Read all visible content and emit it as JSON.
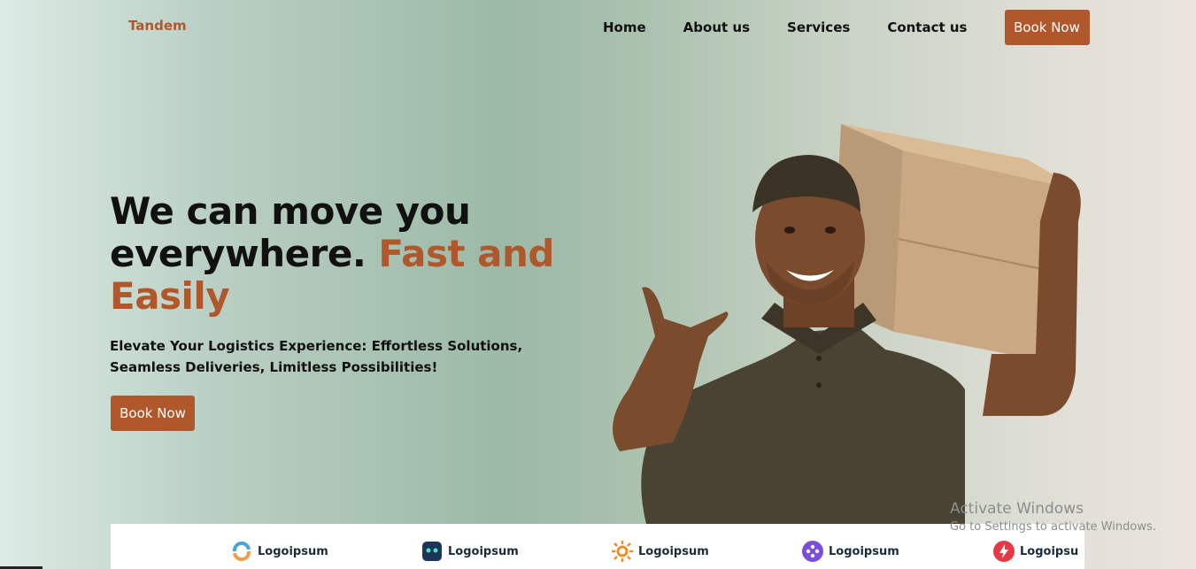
{
  "header": {
    "brand": "Tandem",
    "nav": [
      "Home",
      "About us",
      "Services",
      "Contact us"
    ],
    "cta_label": "Book Now"
  },
  "hero": {
    "title_part1": "We can move you everywhere. ",
    "title_accent": "Fast and Easily",
    "subtitle": "Elevate Your Logistics Experience: Effortless Solutions, Seamless Deliveries, Limitless Possibilities!",
    "cta_label": "Book Now"
  },
  "logos": [
    {
      "label": "Logoipsum",
      "icon": "ring-logo-icon"
    },
    {
      "label": "Logoipsum",
      "icon": "robot-logo-icon"
    },
    {
      "label": "Logoipsum",
      "icon": "sun-logo-icon"
    },
    {
      "label": "Logoipsum",
      "icon": "diamond-logo-icon"
    },
    {
      "label": "Logoipsu",
      "icon": "bolt-logo-icon"
    }
  ],
  "watermark": {
    "title": "Activate Windows",
    "subtitle": "Go to Settings to activate Windows."
  },
  "colors": {
    "accent": "#b0582c"
  }
}
